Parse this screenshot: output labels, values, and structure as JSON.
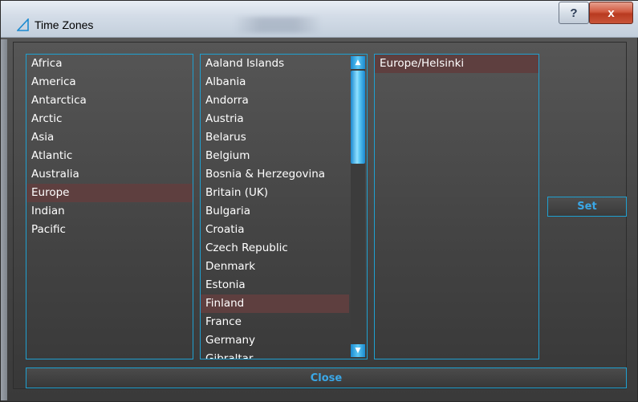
{
  "window": {
    "title": "Time Zones",
    "help_label": "?",
    "close_label": "x"
  },
  "regions": [
    {
      "label": "Africa",
      "selected": false
    },
    {
      "label": "America",
      "selected": false
    },
    {
      "label": "Antarctica",
      "selected": false
    },
    {
      "label": "Arctic",
      "selected": false
    },
    {
      "label": "Asia",
      "selected": false
    },
    {
      "label": "Atlantic",
      "selected": false
    },
    {
      "label": "Australia",
      "selected": false
    },
    {
      "label": "Europe",
      "selected": true
    },
    {
      "label": "Indian",
      "selected": false
    },
    {
      "label": "Pacific",
      "selected": false
    }
  ],
  "countries": [
    {
      "label": "Aaland Islands",
      "selected": false
    },
    {
      "label": "Albania",
      "selected": false
    },
    {
      "label": "Andorra",
      "selected": false
    },
    {
      "label": "Austria",
      "selected": false
    },
    {
      "label": "Belarus",
      "selected": false
    },
    {
      "label": "Belgium",
      "selected": false
    },
    {
      "label": "Bosnia & Herzegovina",
      "selected": false
    },
    {
      "label": "Britain (UK)",
      "selected": false
    },
    {
      "label": "Bulgaria",
      "selected": false
    },
    {
      "label": "Croatia",
      "selected": false
    },
    {
      "label": "Czech Republic",
      "selected": false
    },
    {
      "label": "Denmark",
      "selected": false
    },
    {
      "label": "Estonia",
      "selected": false
    },
    {
      "label": "Finland",
      "selected": true
    },
    {
      "label": "France",
      "selected": false
    },
    {
      "label": "Germany",
      "selected": false
    },
    {
      "label": "Gibraltar",
      "selected": false
    }
  ],
  "zones": [
    {
      "label": "Europe/Helsinki",
      "selected": true
    }
  ],
  "buttons": {
    "set_label": "Set",
    "close_label": "Close"
  },
  "colors": {
    "accent": "#1fa0d0",
    "selection": "#5e3f3f",
    "button_text": "#3aa8e8"
  }
}
